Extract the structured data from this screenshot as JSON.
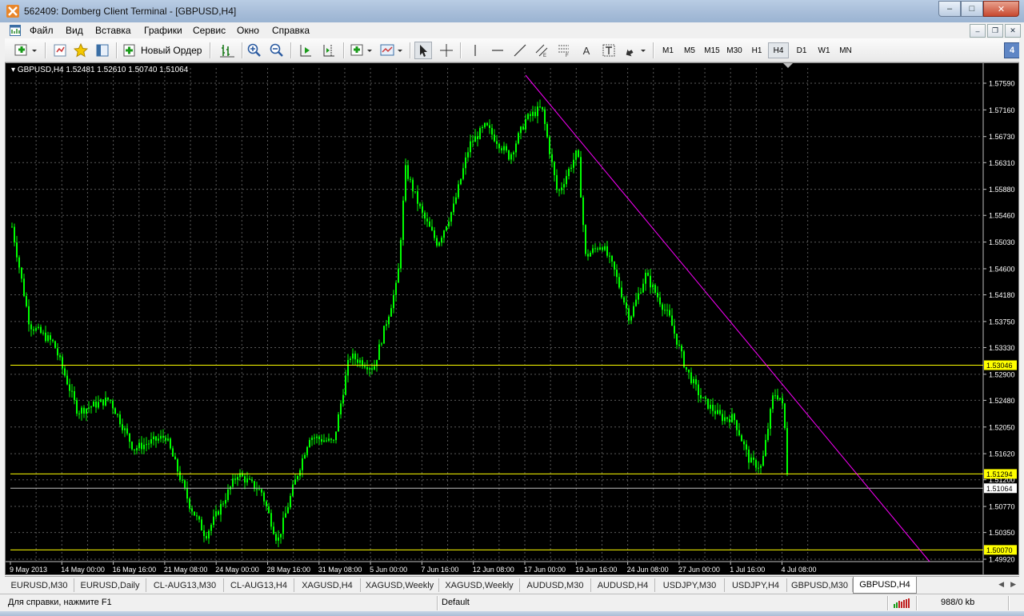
{
  "window": {
    "title": "562409: Domberg Client Terminal - [GBPUSD,H4]",
    "controls": {
      "minimize": "–",
      "maximize": "□",
      "close": "✕"
    }
  },
  "menu": {
    "items": [
      "Файл",
      "Вид",
      "Вставка",
      "Графики",
      "Сервис",
      "Окно",
      "Справка"
    ],
    "mdi": {
      "minimize": "–",
      "restore": "❐",
      "close": "✕"
    }
  },
  "toolbar": {
    "new_order_label": "Новый Ордер",
    "text_tool": "A",
    "timeframes": [
      "M1",
      "M5",
      "M15",
      "M30",
      "H1",
      "H4",
      "D1",
      "W1",
      "MN"
    ],
    "active_timeframe": "H4",
    "badge": "4"
  },
  "chart": {
    "info": "GBPUSD,H4  1.52481 1.52610 1.50740 1.51064",
    "price_labels": [
      "1.57590",
      "1.57160",
      "1.56730",
      "1.56310",
      "1.55880",
      "1.55460",
      "1.55030",
      "1.54600",
      "1.54180",
      "1.53750",
      "1.53330",
      "1.52900",
      "1.52480",
      "1.52050",
      "1.51620",
      "1.51200",
      "1.50770",
      "1.50350",
      "1.49920"
    ],
    "level_labels": {
      "upper": "1.53046",
      "middle": "1.51294",
      "current": "1.51064",
      "lower": "1.50070"
    },
    "time_labels": [
      "9 May 2013",
      "14 May 00:00",
      "16 May 16:00",
      "21 May 08:00",
      "24 May 00:00",
      "28 May 16:00",
      "31 May 08:00",
      "5 Jun 00:00",
      "7 Jun 16:00",
      "12 Jun 08:00",
      "17 Jun 00:00",
      "19 Jun 16:00",
      "24 Jun 08:00",
      "27 Jun 00:00",
      "1 Jul 16:00",
      "4 Jul 08:00"
    ],
    "colors": {
      "background": "#000000",
      "candles": "#00ff00",
      "grid": "#5a5a5a",
      "level": "#ffff00",
      "trendline": "#ff00ff",
      "current_price": "#c0c0c0"
    }
  },
  "tabs": {
    "items": [
      "EURUSD,M30",
      "EURUSD,Daily",
      "CL-AUG13,M30",
      "CL-AUG13,H4",
      "XAGUSD,H4",
      "XAGUSD,Weekly",
      "XAGUSD,Weekly",
      "AUDUSD,M30",
      "AUDUSD,H4",
      "USDJPY,M30",
      "USDJPY,H4",
      "GBPUSD,M30",
      "GBPUSD,H4"
    ],
    "active": "GBPUSD,H4",
    "arrows": {
      "left": "◀",
      "right": "▶"
    }
  },
  "status": {
    "help": "Для справки, нажмите F1",
    "profile": "Default",
    "traffic": "988/0 kb"
  }
}
